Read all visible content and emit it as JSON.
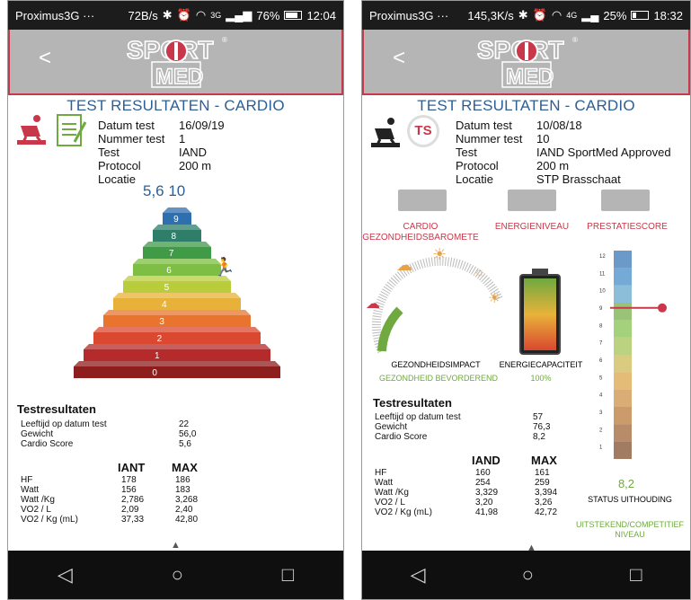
{
  "brand": {
    "logo_top": "SPORT",
    "logo_bottom": "MED"
  },
  "left": {
    "status": {
      "carrier": "Proximus3G",
      "dots": "···",
      "speed": "72B/s",
      "signal": "3G",
      "battery": "76%",
      "battery_level": 0.76,
      "time": "12:04"
    },
    "title": "TEST RESULTATEN - CARDIO",
    "info": [
      {
        "key": "Datum test",
        "value": "16/09/19"
      },
      {
        "key": "Nummer test",
        "value": "1"
      },
      {
        "key": "Test",
        "value": "IAND"
      },
      {
        "key": "Protocol",
        "value": "200 m"
      },
      {
        "key": "Locatie",
        "value": ""
      }
    ],
    "pyramid_overlay": "5,6   10",
    "pyramid_levels": [
      "0",
      "1",
      "2",
      "3",
      "4",
      "5",
      "6",
      "7",
      "8",
      "9"
    ],
    "results_title": "Testresultaten",
    "results": [
      {
        "key": "Leeftijd op datum test",
        "value": "22"
      },
      {
        "key": "Gewicht",
        "value": "56,0"
      },
      {
        "key": "Cardio Score",
        "value": "5,6"
      }
    ],
    "table": {
      "headers": [
        "",
        "IANT",
        "MAX"
      ],
      "rows": [
        [
          "HF",
          "178",
          "186"
        ],
        [
          "Watt",
          "156",
          "183"
        ],
        [
          "Watt /Kg",
          "2,786",
          "3,268"
        ],
        [
          "VO2 / L",
          "2,09",
          "2,40"
        ],
        [
          "VO2 / Kg (mL)",
          "37,33",
          "42,80"
        ]
      ]
    },
    "more": "▲"
  },
  "right": {
    "status": {
      "carrier": "Proximus3G",
      "dots": "···",
      "speed": "145,3K/s",
      "signal": "4G",
      "battery": "25%",
      "battery_level": 0.25,
      "time": "18:32"
    },
    "title": "TEST RESULTATEN - CARDIO",
    "badge": "TS",
    "info": [
      {
        "key": "Datum test",
        "value": "10/08/18"
      },
      {
        "key": "Nummer test",
        "value": "10"
      },
      {
        "key": "Test",
        "value": "IAND SportMed Approved"
      },
      {
        "key": "Protocol",
        "value": "200 m"
      },
      {
        "key": "Locatie",
        "value": "STP Brasschaat"
      }
    ],
    "tabs": [
      "CARDIO\nGEZONDHEIDSBAROMETE",
      "ENERGIENIVEAU",
      "PRESTATIESCORE"
    ],
    "gauge_label": "GEZONDHEIDSIMPACT",
    "gauge_value": "GEZONDHEID BEVORDEREND",
    "battery_label": "ENERGIECAPACITEIT",
    "battery_value": "100%",
    "energy_level": 1.0,
    "scale_value": "8,2",
    "scale_level": 8.2,
    "scale_label": "STATUS UITHOUDING",
    "scale_status": "UITSTEKEND/COMPETITIEF NIVEAU",
    "scale_ticks": [
      "12",
      "11",
      "10",
      "9",
      "8",
      "7",
      "6",
      "5",
      "4",
      "3",
      "2",
      "1"
    ],
    "results_title": "Testresultaten",
    "results": [
      {
        "key": "Leeftijd op datum test",
        "value": "57"
      },
      {
        "key": "Gewicht",
        "value": "76,3"
      },
      {
        "key": "Cardio Score",
        "value": "8,2"
      }
    ],
    "table": {
      "headers": [
        "",
        "IAND",
        "MAX"
      ],
      "rows": [
        [
          "HF",
          "160",
          "161"
        ],
        [
          "Watt",
          "254",
          "259"
        ],
        [
          "Watt /Kg",
          "3,329",
          "3,394"
        ],
        [
          "VO2 / L",
          "3,20",
          "3,26"
        ],
        [
          "VO2 / Kg (mL)",
          "41,98",
          "42,72"
        ]
      ]
    },
    "more": "▲"
  },
  "nav": {
    "back": "◁",
    "home": "○",
    "recent": "□"
  },
  "colors": {
    "brand_red": "#c9384a",
    "title_blue": "#2d5f95",
    "green": "#6fa93f"
  }
}
